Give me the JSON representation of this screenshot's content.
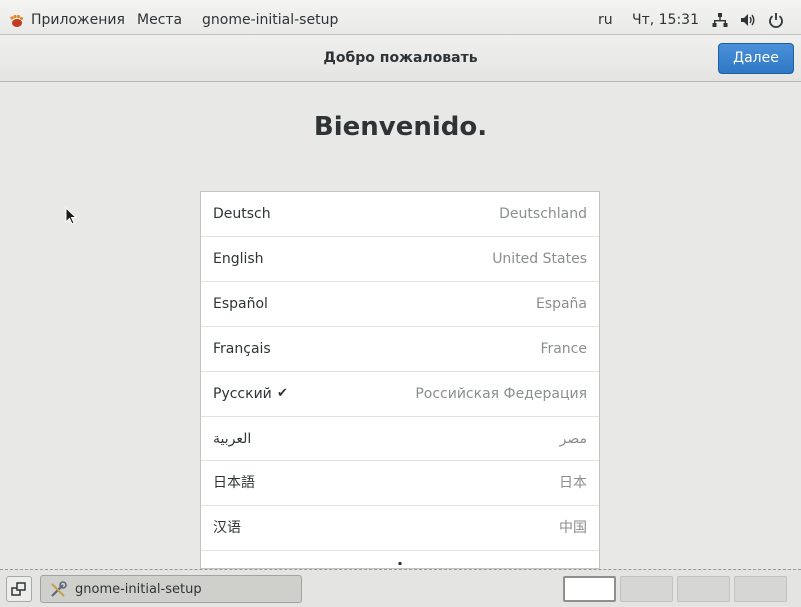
{
  "top_panel": {
    "applications_label": "Приложения",
    "places_label": "Места",
    "app_name": "gnome-initial-setup",
    "keyboard_layout": "ru",
    "clock": "Чт, 15:31",
    "icons": [
      "network-icon",
      "volume-icon",
      "power-icon"
    ]
  },
  "header": {
    "title": "Добро пожаловать",
    "next_label": "Далее",
    "accent_color": "#3584e4"
  },
  "main": {
    "welcome_text": "Bienvenido.",
    "languages": [
      {
        "name": "Deutsch",
        "region": "Deutschland",
        "selected": false
      },
      {
        "name": "English",
        "region": "United States",
        "selected": false
      },
      {
        "name": "Español",
        "region": "España",
        "selected": false
      },
      {
        "name": "Français",
        "region": "France",
        "selected": false
      },
      {
        "name": "Русский",
        "region": "Российская Федерация",
        "selected": true
      },
      {
        "name": "العربية",
        "region": "مصر",
        "selected": false
      },
      {
        "name": "日本語",
        "region": "日本",
        "selected": false
      },
      {
        "name": "汉语",
        "region": "中国",
        "selected": false
      }
    ],
    "check_mark": "✔"
  },
  "bottom_panel": {
    "task_label": "gnome-initial-setup",
    "workspaces": [
      {
        "active": true
      },
      {
        "active": false
      },
      {
        "active": false
      },
      {
        "active": false
      }
    ]
  }
}
